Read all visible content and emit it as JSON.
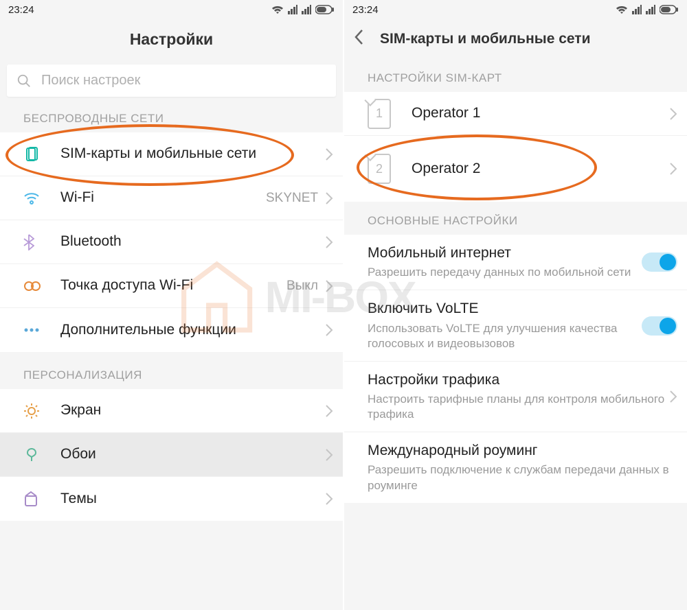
{
  "status": {
    "time": "23:24"
  },
  "left": {
    "title": "Настройки",
    "search_placeholder": "Поиск настроек",
    "section_wireless": "БЕСПРОВОДНЫЕ СЕТИ",
    "sim": "SIM-карты и мобильные сети",
    "wifi": "Wi-Fi",
    "wifi_value": "SKYNET",
    "bluetooth": "Bluetooth",
    "hotspot": "Точка доступа Wi-Fi",
    "hotspot_value": "Выкл",
    "more": "Дополнительные функции",
    "section_personal": "ПЕРСОНАЛИЗАЦИЯ",
    "display": "Экран",
    "wallpaper": "Обои",
    "themes": "Темы"
  },
  "right": {
    "title": "SIM-карты и мобильные сети",
    "section_sim": "НАСТРОЙКИ SIM-КАРТ",
    "operator1": "Operator 1",
    "operator2": "Operator 2",
    "sim1_digit": "1",
    "sim2_digit": "2",
    "section_general": "ОСНОВНЫЕ НАСТРОЙКИ",
    "mobile_data": "Мобильный интернет",
    "mobile_data_sub": "Разрешить передачу данных по мобильной сети",
    "volte": "Включить VoLTE",
    "volte_sub": "Использовать VoLTE для улучшения качества голосовых и видеовызовов",
    "traffic": "Настройки трафика",
    "traffic_sub": "Настроить тарифные планы для контроля мобильного трафика",
    "roaming": "Международный роуминг",
    "roaming_sub": "Разрешить подключение к службам передачи данных в роуминге"
  },
  "watermark": "MI-BOX"
}
